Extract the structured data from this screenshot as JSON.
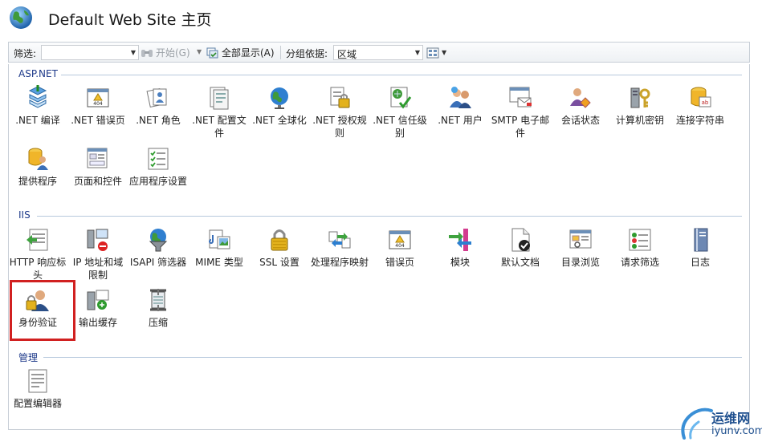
{
  "header": {
    "title": "Default Web Site 主页"
  },
  "toolbar": {
    "filter_label": "筛选:",
    "filter_value": "",
    "start_label": "开始(G)",
    "show_all_label": "全部显示(A)",
    "group_by_label": "分组依据:",
    "group_by_value": "区域"
  },
  "groups": {
    "aspnet": {
      "title": "ASP.NET",
      "items": [
        {
          "label": ".NET 编译",
          "icon": "compile-icon"
        },
        {
          "label": ".NET 错误页",
          "icon": "error-page-icon"
        },
        {
          "label": ".NET 角色",
          "icon": "roles-icon"
        },
        {
          "label": ".NET 配置文件",
          "icon": "profile-icon"
        },
        {
          "label": ".NET 全球化",
          "icon": "globalization-icon"
        },
        {
          "label": ".NET 授权规则",
          "icon": "authorization-icon"
        },
        {
          "label": ".NET 信任级别",
          "icon": "trust-level-icon"
        },
        {
          "label": ".NET 用户",
          "icon": "users-icon"
        },
        {
          "label": "SMTP 电子邮件",
          "icon": "smtp-icon"
        },
        {
          "label": "会话状态",
          "icon": "session-state-icon"
        },
        {
          "label": "计算机密钥",
          "icon": "machine-key-icon"
        },
        {
          "label": "连接字符串",
          "icon": "connection-strings-icon"
        },
        {
          "label": "提供程序",
          "icon": "providers-icon"
        },
        {
          "label": "页面和控件",
          "icon": "pages-controls-icon"
        },
        {
          "label": "应用程序设置",
          "icon": "app-settings-icon"
        }
      ]
    },
    "iis": {
      "title": "IIS",
      "items": [
        {
          "label": "HTTP 响应标头",
          "icon": "http-headers-icon"
        },
        {
          "label": "IP 地址和域限制",
          "icon": "ip-restrictions-icon"
        },
        {
          "label": "ISAPI 筛选器",
          "icon": "isapi-filters-icon"
        },
        {
          "label": "MIME 类型",
          "icon": "mime-types-icon"
        },
        {
          "label": "SSL 设置",
          "icon": "ssl-lock-icon"
        },
        {
          "label": "处理程序映射",
          "icon": "handler-mappings-icon"
        },
        {
          "label": "错误页",
          "icon": "error-pages-icon"
        },
        {
          "label": "模块",
          "icon": "modules-icon"
        },
        {
          "label": "默认文档",
          "icon": "default-document-icon"
        },
        {
          "label": "目录浏览",
          "icon": "directory-browsing-icon"
        },
        {
          "label": "请求筛选",
          "icon": "request-filtering-icon"
        },
        {
          "label": "日志",
          "icon": "logging-icon"
        },
        {
          "label": "身份验证",
          "icon": "authentication-icon"
        },
        {
          "label": "输出缓存",
          "icon": "output-caching-icon"
        },
        {
          "label": "压缩",
          "icon": "compression-icon"
        }
      ]
    },
    "management": {
      "title": "管理",
      "items": [
        {
          "label": "配置编辑器",
          "icon": "configuration-editor-icon"
        }
      ]
    }
  },
  "watermark": {
    "text1": "运维网",
    "text2": "iyunv.com"
  }
}
